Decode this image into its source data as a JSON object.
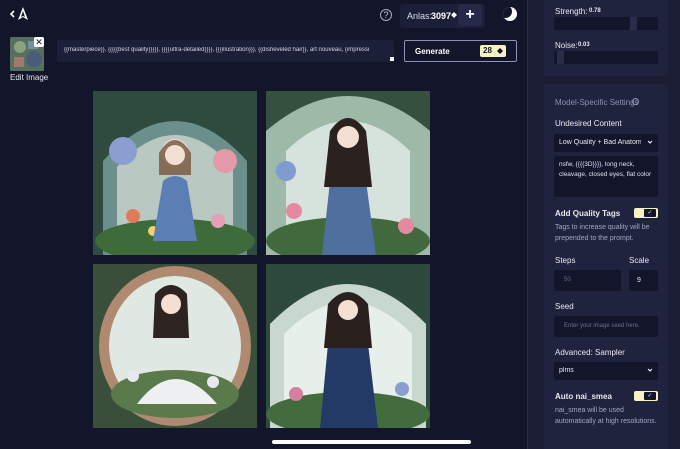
{
  "topbar": {
    "anlas_label": "Anlas:",
    "anlas_value": "3097",
    "add_label": "+",
    "help_glyph": "?"
  },
  "prompt": {
    "edit_label": "Edit Image",
    "text": "{{masterpiece}}, {{{{{best quality}}}}}, {{{{ultra-detailed}}}}, {{{illustration}}}, {{disheveled hair}}, art nouveau, {impressi",
    "close_glyph": "✕"
  },
  "generate": {
    "label": "Generate",
    "cost": "28"
  },
  "params": {
    "strength_label": "Strength:",
    "strength_value": "0.78",
    "strength_fraction": 0.78,
    "noise_label": "Noise:",
    "noise_value": "0.03",
    "noise_fraction": 0.03
  },
  "model_settings": {
    "title": "Model-Specific Settings",
    "info_glyph": "?",
    "undesired_label": "Undesired Content",
    "undesired_preset": "Low Quality + Bad Anatomy",
    "undesired_text": "nsfw, {{{{3D}}}}, long neck, cleavage, closed eyes, flat color",
    "quality_tags_label": "Add Quality Tags",
    "quality_tags_on": true,
    "quality_tags_hint": "Tags to increase quality will be prepended to the prompt.",
    "steps_label": "Steps",
    "steps_value": "50",
    "scale_label": "Scale",
    "scale_value": "9",
    "seed_label": "Seed",
    "seed_placeholder": "Enter your image seed here.",
    "sampler_label": "Advanced: Sampler",
    "sampler_value": "plms",
    "smea_label": "Auto nai_smea",
    "smea_on": true,
    "smea_hint": "nai_smea will be used automatically at high resolutions."
  },
  "colors": {
    "background": "#13152a",
    "panel": "#20233d",
    "accent": "#f5f3c2"
  }
}
